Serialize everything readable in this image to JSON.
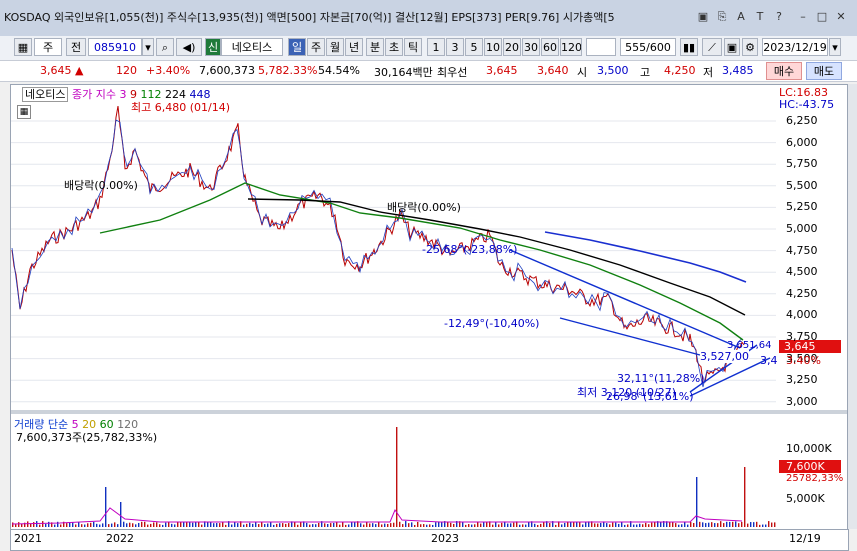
{
  "titlebar": {
    "text": "KOSDAQ 외국인보유[1,055(천)] 주식수[13,935(천)] 액면[500] 자본금[70(억)] 결산[12월] EPS[373] PER[9.76] 시가총액[5",
    "icons": [
      "window-icon",
      "copy-icon",
      "font-icon",
      "text-icon",
      "help-icon",
      "minimize-icon",
      "maximize-icon",
      "close-icon"
    ]
  },
  "toolbar": {
    "type_select": "주",
    "prev_label": "전",
    "code_value": "085910",
    "market_badge": "신",
    "stock_name": "네오티스",
    "periods": [
      "일",
      "주",
      "월",
      "년",
      "분",
      "초",
      "틱"
    ],
    "period_active": "일",
    "intervals": [
      "1",
      "3",
      "5",
      "10",
      "20",
      "30",
      "60",
      "120"
    ],
    "count": "555/600",
    "date_value": "2023/12/19"
  },
  "quote": {
    "price": "3,645",
    "arrow": "▲",
    "change": "120",
    "change_pct": "+3.40%",
    "volume": "7,600,373",
    "vol_ratio": "5,782.33%",
    "turnover": "54.54%",
    "amount": "30,164백만",
    "best_label": "최우선",
    "best_ask": "3,645",
    "best_bid": "3,640",
    "open_label": "시",
    "open": "3,500",
    "high_label": "고",
    "high": "4,250",
    "low_label": "저",
    "low": "3,485",
    "buy_label": "매수",
    "sell_label": "매도"
  },
  "chart": {
    "stock_label": "네오티스",
    "ma_label": "종가 지수 3",
    "ma_periods": [
      "9",
      "112",
      "224",
      "448"
    ],
    "ma_colors": [
      "#c00000",
      "#008000",
      "#000000",
      "#0000c0"
    ],
    "lc": "LC:16.83",
    "hc": "HC:-43.75",
    "price_axis": [
      "6,250",
      "6,000",
      "5,750",
      "5,500",
      "5,250",
      "5,000",
      "4,750",
      "4,500",
      "4,250",
      "4,000",
      "3,750",
      "3,500",
      "3,250",
      "3,000"
    ],
    "current_price_tag": "3,645",
    "current_pct_tag": "3.40%",
    "annotations": {
      "high": "최고 6,480 (01/14)",
      "dividend1": "배당락(0.00%)",
      "dividend2": "배당락(0.00%)",
      "angle1": "-25,68°(-23,88%)",
      "angle2": "-12,49°(-10,40%)",
      "low": "최저 3,120 (10/27)",
      "angle3": "32,11°(11,28%)",
      "angle4": "26,98°(13,61%)",
      "price1": "3,527,00",
      "price2": "3,651,64",
      "price3": "3,4"
    }
  },
  "volume_panel": {
    "title": "거래량",
    "ma_label": "단순",
    "ma_periods": [
      "5",
      "20",
      "60",
      "120"
    ],
    "ma_colors": [
      "#c000c0",
      "#c0a000",
      "#008000",
      "#707070"
    ],
    "value_text": "7,600,373주(25,782,33%)",
    "axis_top": "10,000K",
    "axis_mid": "5,000K",
    "current_tag": "7,600K",
    "current_pct": "25782,33%"
  },
  "xaxis": {
    "labels": [
      "2021",
      "2022",
      "2023",
      "12/19"
    ]
  }
}
